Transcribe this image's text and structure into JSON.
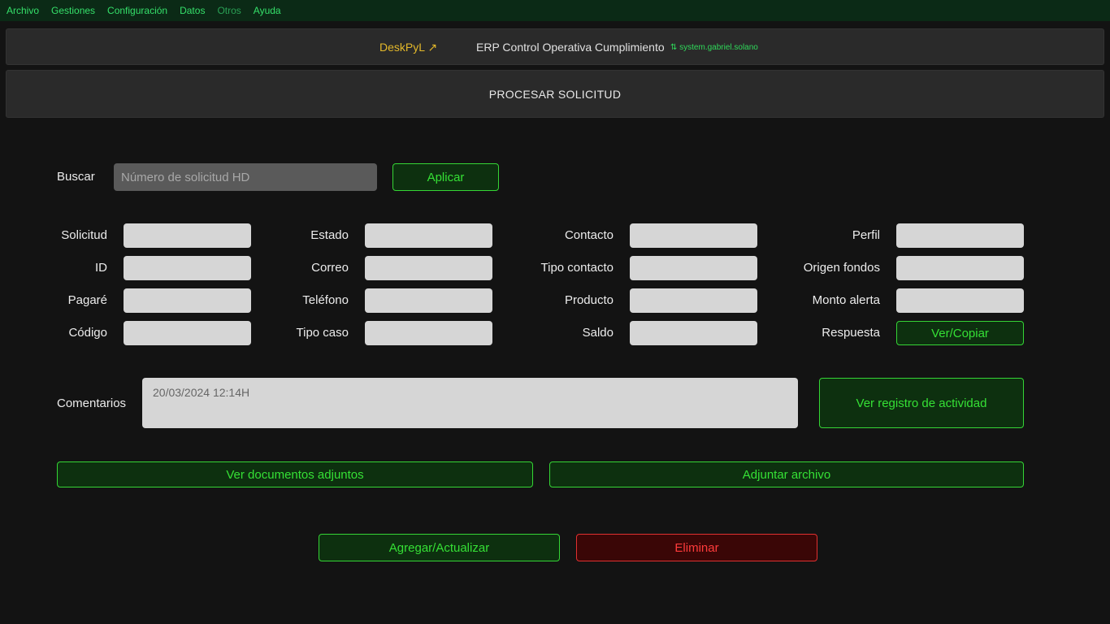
{
  "menu": {
    "items": [
      "Archivo",
      "Gestiones",
      "Configuración",
      "Datos",
      "Otros",
      "Ayuda"
    ]
  },
  "header": {
    "brand": "DeskPyL ↗",
    "title": "ERP Control Operativa Cumplimiento",
    "user": "⇅ system.gabriel.solano"
  },
  "page": {
    "title": "PROCESAR SOLICITUD"
  },
  "search": {
    "label": "Buscar",
    "placeholder": "Número de solicitud HD",
    "apply_label": "Aplicar"
  },
  "fields": {
    "col1": [
      "Solicitud",
      "ID",
      "Pagaré",
      "Código"
    ],
    "col2": [
      "Estado",
      "Correo",
      "Teléfono",
      "Tipo caso"
    ],
    "col3": [
      "Contacto",
      "Tipo contacto",
      "Producto",
      "Saldo"
    ],
    "col4": [
      "Perfil",
      "Origen fondos",
      "Monto alerta",
      "Respuesta"
    ]
  },
  "respuesta_button": "Ver/Copiar",
  "comments": {
    "label": "Comentarios",
    "value": "20/03/2024 12:14H"
  },
  "actions": {
    "activity_log": "Ver registro de actividad",
    "view_attachments": "Ver documentos adjuntos",
    "attach_file": "Adjuntar archivo",
    "add_update": "Agregar/Actualizar",
    "delete": "Eliminar"
  },
  "colors": {
    "accent_green": "#35e035",
    "danger_red": "#ff3b3b",
    "brand_yellow": "#e3b82a",
    "menubar_bg": "#0b2a16"
  }
}
